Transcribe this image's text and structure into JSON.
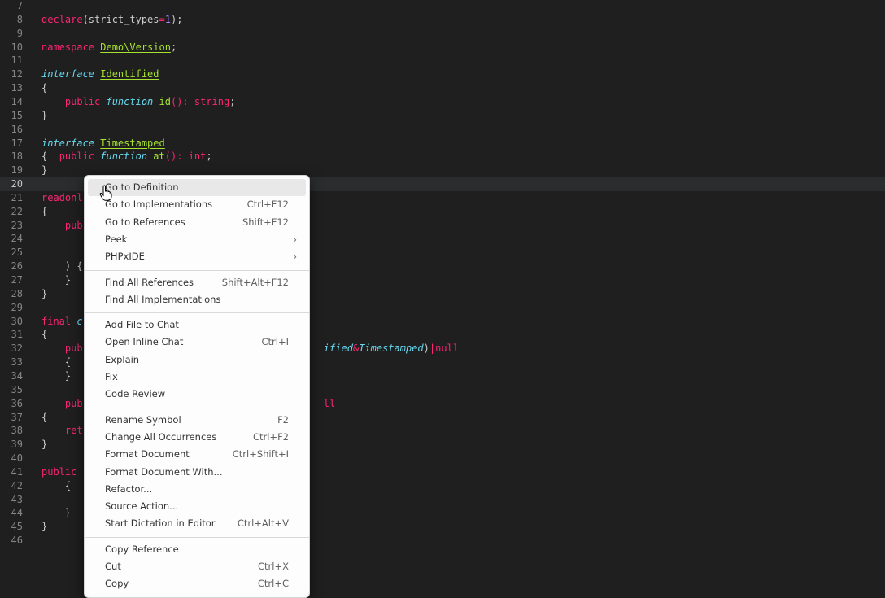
{
  "editor": {
    "lines": [
      {
        "n": "7",
        "tokens": []
      },
      {
        "n": "8",
        "tokens": [
          {
            "t": "declare",
            "c": "tok-kw"
          },
          {
            "t": "(strict_types",
            "c": "tok-plain"
          },
          {
            "t": "=",
            "c": "tok-kw"
          },
          {
            "t": "1",
            "c": "tok-num"
          },
          {
            "t": ");",
            "c": "tok-plain"
          }
        ]
      },
      {
        "n": "9",
        "tokens": []
      },
      {
        "n": "10",
        "tokens": [
          {
            "t": "namespace ",
            "c": "tok-kw"
          },
          {
            "t": "Demo\\Version",
            "c": "tok-type"
          },
          {
            "t": ";",
            "c": "tok-plain"
          }
        ]
      },
      {
        "n": "11",
        "tokens": []
      },
      {
        "n": "12",
        "tokens": [
          {
            "t": "interface ",
            "c": "tok-kwi"
          },
          {
            "t": "Identified",
            "c": "tok-type"
          }
        ]
      },
      {
        "n": "13",
        "tokens": [
          {
            "t": "{",
            "c": "tok-plain"
          }
        ]
      },
      {
        "n": "14",
        "tokens": [
          {
            "t": "    public ",
            "c": "tok-kw"
          },
          {
            "t": "function ",
            "c": "tok-kwi"
          },
          {
            "t": "id",
            "c": "tok-fn"
          },
          {
            "t": "(): ",
            "c": "tok-kw"
          },
          {
            "t": "string",
            "c": "tok-kw"
          },
          {
            "t": ";",
            "c": "tok-plain"
          }
        ]
      },
      {
        "n": "15",
        "tokens": [
          {
            "t": "}",
            "c": "tok-plain"
          }
        ]
      },
      {
        "n": "16",
        "tokens": []
      },
      {
        "n": "17",
        "tokens": [
          {
            "t": "interface ",
            "c": "tok-kwi"
          },
          {
            "t": "Timestamped",
            "c": "tok-type"
          }
        ]
      },
      {
        "n": "18",
        "tokens": [
          {
            "t": "{  ",
            "c": "tok-plain"
          },
          {
            "t": "public ",
            "c": "tok-kw"
          },
          {
            "t": "function ",
            "c": "tok-kwi"
          },
          {
            "t": "at",
            "c": "tok-fn"
          },
          {
            "t": "(): ",
            "c": "tok-kw"
          },
          {
            "t": "int",
            "c": "tok-kw"
          },
          {
            "t": ";",
            "c": "tok-plain"
          }
        ]
      },
      {
        "n": "19",
        "tokens": [
          {
            "t": "}",
            "c": "tok-plain"
          }
        ]
      },
      {
        "n": "20",
        "tokens": [],
        "current": true
      },
      {
        "n": "21",
        "tokens": [
          {
            "t": "readonl",
            "c": "tok-kw"
          }
        ]
      },
      {
        "n": "22",
        "tokens": [
          {
            "t": "{",
            "c": "tok-plain"
          }
        ]
      },
      {
        "n": "23",
        "tokens": [
          {
            "t": "    pub",
            "c": "tok-kw"
          }
        ]
      },
      {
        "n": "24",
        "tokens": [
          {
            "t": "    ",
            "c": "tok-plain"
          }
        ]
      },
      {
        "n": "25",
        "tokens": [
          {
            "t": "    ",
            "c": "tok-plain"
          }
        ]
      },
      {
        "n": "26",
        "tokens": [
          {
            "t": "    ) {",
            "c": "tok-plain"
          }
        ]
      },
      {
        "n": "27",
        "tokens": [
          {
            "t": "    }",
            "c": "tok-plain"
          }
        ]
      },
      {
        "n": "28",
        "tokens": [
          {
            "t": "}",
            "c": "tok-plain"
          }
        ]
      },
      {
        "n": "29",
        "tokens": []
      },
      {
        "n": "30",
        "tokens": [
          {
            "t": "final ",
            "c": "tok-kw"
          },
          {
            "t": "c",
            "c": "tok-kwi"
          }
        ]
      },
      {
        "n": "31",
        "tokens": [
          {
            "t": "{",
            "c": "tok-plain"
          }
        ]
      },
      {
        "n": "32",
        "tokens": [
          {
            "t": "    pub",
            "c": "tok-kw"
          },
          {
            "t": "                                         ",
            "c": "tok-plain"
          },
          {
            "t": "ified",
            "c": "tok-kwi"
          },
          {
            "t": "&",
            "c": "tok-kw"
          },
          {
            "t": "Timestamped",
            "c": "tok-kwi"
          },
          {
            "t": ")",
            "c": "tok-plain"
          },
          {
            "t": "|",
            "c": "tok-kw"
          },
          {
            "t": "null",
            "c": "tok-kw"
          }
        ]
      },
      {
        "n": "33",
        "tokens": [
          {
            "t": "    {",
            "c": "tok-plain"
          }
        ]
      },
      {
        "n": "34",
        "tokens": [
          {
            "t": "    }",
            "c": "tok-plain"
          }
        ]
      },
      {
        "n": "35",
        "tokens": []
      },
      {
        "n": "36",
        "tokens": [
          {
            "t": "    pub",
            "c": "tok-kw"
          },
          {
            "t": "                                         ",
            "c": "tok-plain"
          },
          {
            "t": "ll",
            "c": "tok-kw"
          }
        ]
      },
      {
        "n": "37",
        "tokens": [
          {
            "t": "{",
            "c": "tok-plain"
          }
        ]
      },
      {
        "n": "38",
        "tokens": [
          {
            "t": "    ret",
            "c": "tok-kw"
          }
        ]
      },
      {
        "n": "39",
        "tokens": [
          {
            "t": "}",
            "c": "tok-plain"
          }
        ]
      },
      {
        "n": "40",
        "tokens": []
      },
      {
        "n": "41",
        "tokens": [
          {
            "t": "public",
            "c": "tok-kw"
          }
        ]
      },
      {
        "n": "42",
        "tokens": [
          {
            "t": "    {",
            "c": "tok-plain"
          }
        ]
      },
      {
        "n": "43",
        "tokens": []
      },
      {
        "n": "44",
        "tokens": [
          {
            "t": "    }",
            "c": "tok-plain"
          }
        ]
      },
      {
        "n": "45",
        "tokens": [
          {
            "t": "}",
            "c": "tok-plain"
          }
        ]
      },
      {
        "n": "46",
        "tokens": []
      }
    ]
  },
  "context_menu": {
    "groups": [
      [
        {
          "label": "Go to Definition",
          "key": "",
          "hover": true
        },
        {
          "label": "Go to Implementations",
          "key": "Ctrl+F12"
        },
        {
          "label": "Go to References",
          "key": "Shift+F12"
        },
        {
          "label": "Peek",
          "key": "",
          "submenu": true
        },
        {
          "label": "PHPxIDE",
          "key": "",
          "submenu": true
        }
      ],
      [
        {
          "label": "Find All References",
          "key": "Shift+Alt+F12"
        },
        {
          "label": "Find All Implementations",
          "key": ""
        }
      ],
      [
        {
          "label": "Add File to Chat",
          "key": ""
        },
        {
          "label": "Open Inline Chat",
          "key": "Ctrl+I"
        },
        {
          "label": "Explain",
          "key": ""
        },
        {
          "label": "Fix",
          "key": ""
        },
        {
          "label": "Code Review",
          "key": ""
        }
      ],
      [
        {
          "label": "Rename Symbol",
          "key": "F2"
        },
        {
          "label": "Change All Occurrences",
          "key": "Ctrl+F2"
        },
        {
          "label": "Format Document",
          "key": "Ctrl+Shift+I"
        },
        {
          "label": "Format Document With...",
          "key": ""
        },
        {
          "label": "Refactor...",
          "key": ""
        },
        {
          "label": "Source Action...",
          "key": ""
        },
        {
          "label": "Start Dictation in Editor",
          "key": "Ctrl+Alt+V"
        }
      ],
      [
        {
          "label": "Copy Reference",
          "key": ""
        },
        {
          "label": "Cut",
          "key": "Ctrl+X"
        },
        {
          "label": "Copy",
          "key": "Ctrl+C"
        }
      ]
    ],
    "submenu_icon": "chevron-right-icon"
  },
  "pointer": {
    "icon": "hand-pointer-icon"
  }
}
